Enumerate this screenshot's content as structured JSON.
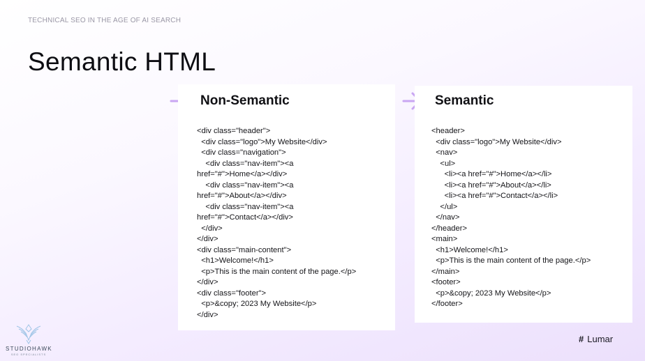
{
  "slide": {
    "eyebrow": "TECHNICAL SEO IN THE AGE OF AI SEARCH",
    "title": "Semantic HTML"
  },
  "panels": {
    "non_semantic": {
      "title": "Non-Semantic",
      "code": "<div class=\"header\">\n  <div class=\"logo\">My Website</div>\n  <div class=\"navigation\">\n    <div class=\"nav-item\"><a\nhref=\"#\">Home</a></div>\n    <div class=\"nav-item\"><a\nhref=\"#\">About</a></div>\n    <div class=\"nav-item\"><a\nhref=\"#\">Contact</a></div>\n  </div>\n</div>\n<div class=\"main-content\">\n  <h1>Welcome!</h1>\n  <p>This is the main content of the page.</p>\n</div>\n<div class=\"footer\">\n  <p>&copy; 2023 My Website</p>\n</div>"
    },
    "semantic": {
      "title": "Semantic",
      "code": "<header>\n  <div class=\"logo\">My Website</div>\n  <nav>\n    <ul>\n      <li><a href=\"#\">Home</a></li>\n      <li><a href=\"#\">About</a></li>\n      <li><a href=\"#\">Contact</a></li>\n    </ul>\n  </nav>\n</header>\n<main>\n  <h1>Welcome!</h1>\n  <p>This is the main content of the page.</p>\n</main>\n<footer>\n  <p>&copy; 2023 My Website</p>\n</footer>"
    }
  },
  "footer": {
    "left_brand": "STUDIOHAWK",
    "left_tagline": "SEO SPECIALISTS",
    "right_brand": "Lumar",
    "right_brand_icon": "hash-icon"
  },
  "colors": {
    "arrow": "#c9a6f2",
    "panel": "#ffffff",
    "logo_line": "#9ec4e6"
  },
  "icons": {
    "panel_marker": "arrow-right-icon",
    "left_logo": "hawk-icon"
  }
}
